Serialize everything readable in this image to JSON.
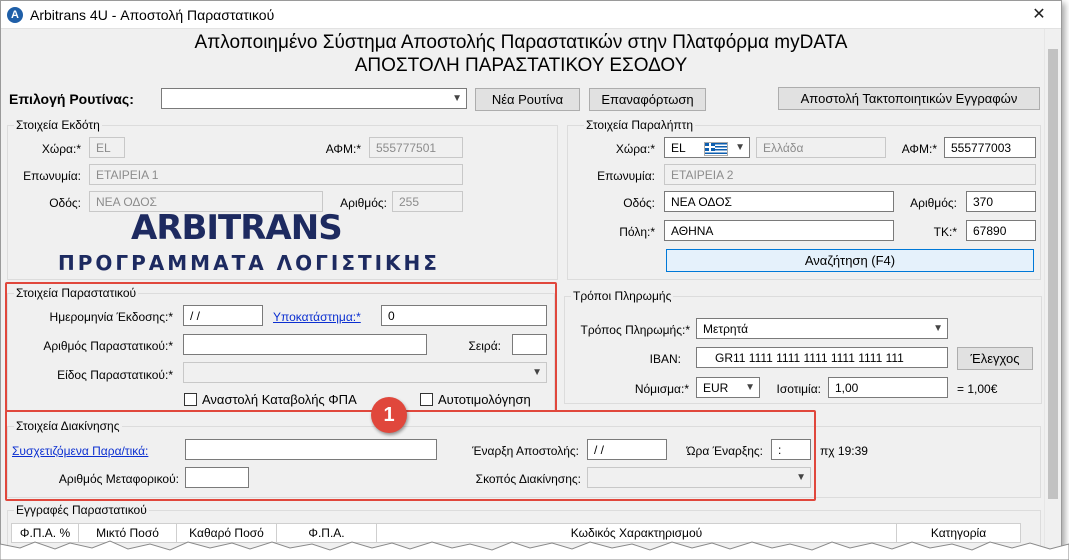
{
  "window": {
    "title": "Arbitrans 4U - Αποστολή Παραστατικού",
    "close": "✕"
  },
  "header": {
    "line1": "Απλοποιημένο Σύστημα Αποστολής Παραστατικών στην Πλατφόρμα myDATA",
    "line2": "ΑΠΟΣΤΟΛΗ ΠΑΡΑΣΤΑΤΙΚΟΥ ΕΣΟΔΟΥ"
  },
  "routine": {
    "label": "Επιλογή Ρουτίνας:",
    "value": "",
    "new_button": "Νέα Ρουτίνα",
    "reload_button": "Επαναφόρτωση",
    "send_corrections_button": "Αποστολή Τακτοποιητικών Εγγραφών"
  },
  "issuer": {
    "title": "Στοιχεία Εκδότη",
    "country_label": "Χώρα:*",
    "country": "EL",
    "afm_label": "ΑΦΜ:*",
    "afm": "555777501",
    "name_label": "Επωνυμία:",
    "name": "ΕΤΑΙΡΕΙΑ 1",
    "street_label": "Οδός:",
    "street": "ΝΕΑ ΟΔΟΣ",
    "number_label": "Αριθμός:",
    "number": "255"
  },
  "logo": {
    "line1": "ARBITRANS",
    "line2": "ΠΡΟΓΡΑΜΜΑΤΑ ΛΟΓΙΣΤΙΚΗΣ"
  },
  "recipient": {
    "title": "Στοιχεία Παραλήπτη",
    "country_label": "Χώρα:*",
    "country_code": "EL",
    "country_name": "Ελλάδα",
    "afm_label": "ΑΦΜ:*",
    "afm": "555777003",
    "name_label": "Επωνυμία:",
    "name": "ΕΤΑΙΡΕΙΑ 2",
    "street_label": "Οδός:",
    "street": "ΝΕΑ ΟΔΟΣ",
    "number_label": "Αριθμός:",
    "number": "370",
    "city_label": "Πόλη:*",
    "city": "ΑΘΗΝΑ",
    "zip_label": "ΤΚ:*",
    "zip": "67890",
    "search_button": "Αναζήτηση (F4)"
  },
  "document": {
    "title": "Στοιχεία Παραστατικού",
    "date_label": "Ημερομηνία Έκδοσης:*",
    "date": " / /",
    "branch_label": "Υποκατάστημα:*",
    "branch": "0",
    "number_label": "Αριθμός Παραστατικού:*",
    "number": "",
    "series_label": "Σειρά:",
    "series": "",
    "type_label": "Είδος Παραστατικού:*",
    "type": "",
    "vat_suspension_label": "Αναστολή Καταβολής ΦΠΑ",
    "self_invoicing_label": "Αυτοτιμολόγηση"
  },
  "payment": {
    "title": "Τρόποι Πληρωμής",
    "method_label": "Τρόπος Πληρωμής:*",
    "method": "Μετρητά",
    "iban_label": "IBAN:",
    "iban": "GR11 1111 1111 1111 1111 1111 111",
    "check_button": "Έλεγχος",
    "currency_label": "Νόμισμα:*",
    "currency": "EUR",
    "rate_label": "Ισοτιμία:",
    "rate": "1,00",
    "equals": "= 1,00€"
  },
  "movement": {
    "title": "Στοιχεία Διακίνησης",
    "related_label": "Συσχετιζόμενα Παρα/τικά:",
    "related": "",
    "start_label": "Έναρξη Αποστολής:",
    "start": " / /",
    "time_label": "Ώρα Έναρξης:",
    "time": " :",
    "time_example": "πχ 19:39",
    "carrier_label": "Αριθμός Μεταφορικού:",
    "carrier": "",
    "purpose_label": "Σκοπός Διακίνησης:",
    "purpose": ""
  },
  "entries": {
    "title": "Εγγραφές Παραστατικού",
    "columns": [
      "Φ.Π.Α. %",
      "Μικτό Ποσό",
      "Καθαρό Ποσό",
      "Φ.Π.Α.",
      "Κωδικός Χαρακτηρισμού",
      "Κατηγορία"
    ]
  },
  "annotation": {
    "badge": "1",
    "highlight_color": "#e0473c"
  }
}
